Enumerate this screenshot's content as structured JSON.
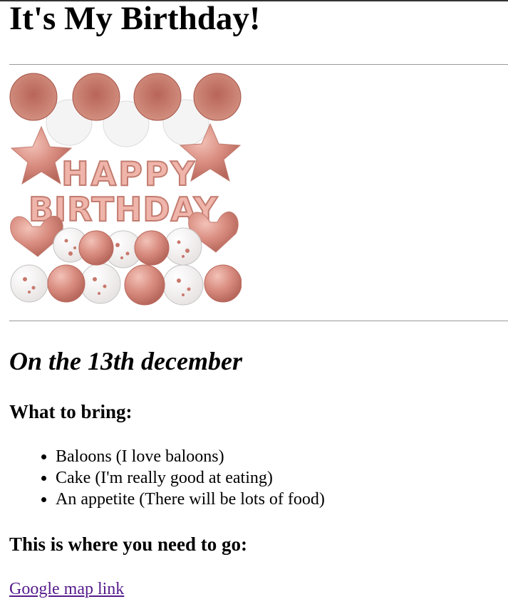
{
  "page": {
    "title": "It's My Birthday!",
    "banner_image": {
      "icon": "happy-birthday-balloons-decoration",
      "letters_line1": "HAPPY",
      "letters_line2": "BIRTHDAY",
      "colors": {
        "rose_gold": "#c27c70",
        "rose_light": "#e8a79b",
        "white_pompom": "#f1f1f1"
      }
    },
    "date": "On the 13th december",
    "bring_heading": "What to bring:",
    "bring_items": [
      "Baloons (I love baloons)",
      "Cake (I'm really good at eating)",
      "An appetite (There will be lots of food)"
    ],
    "directions_heading": "This is where you need to go:",
    "map_link_label": "Google map link"
  },
  "colors": {
    "link_visited": "#551a8b",
    "divider": "#9a9a9a"
  }
}
